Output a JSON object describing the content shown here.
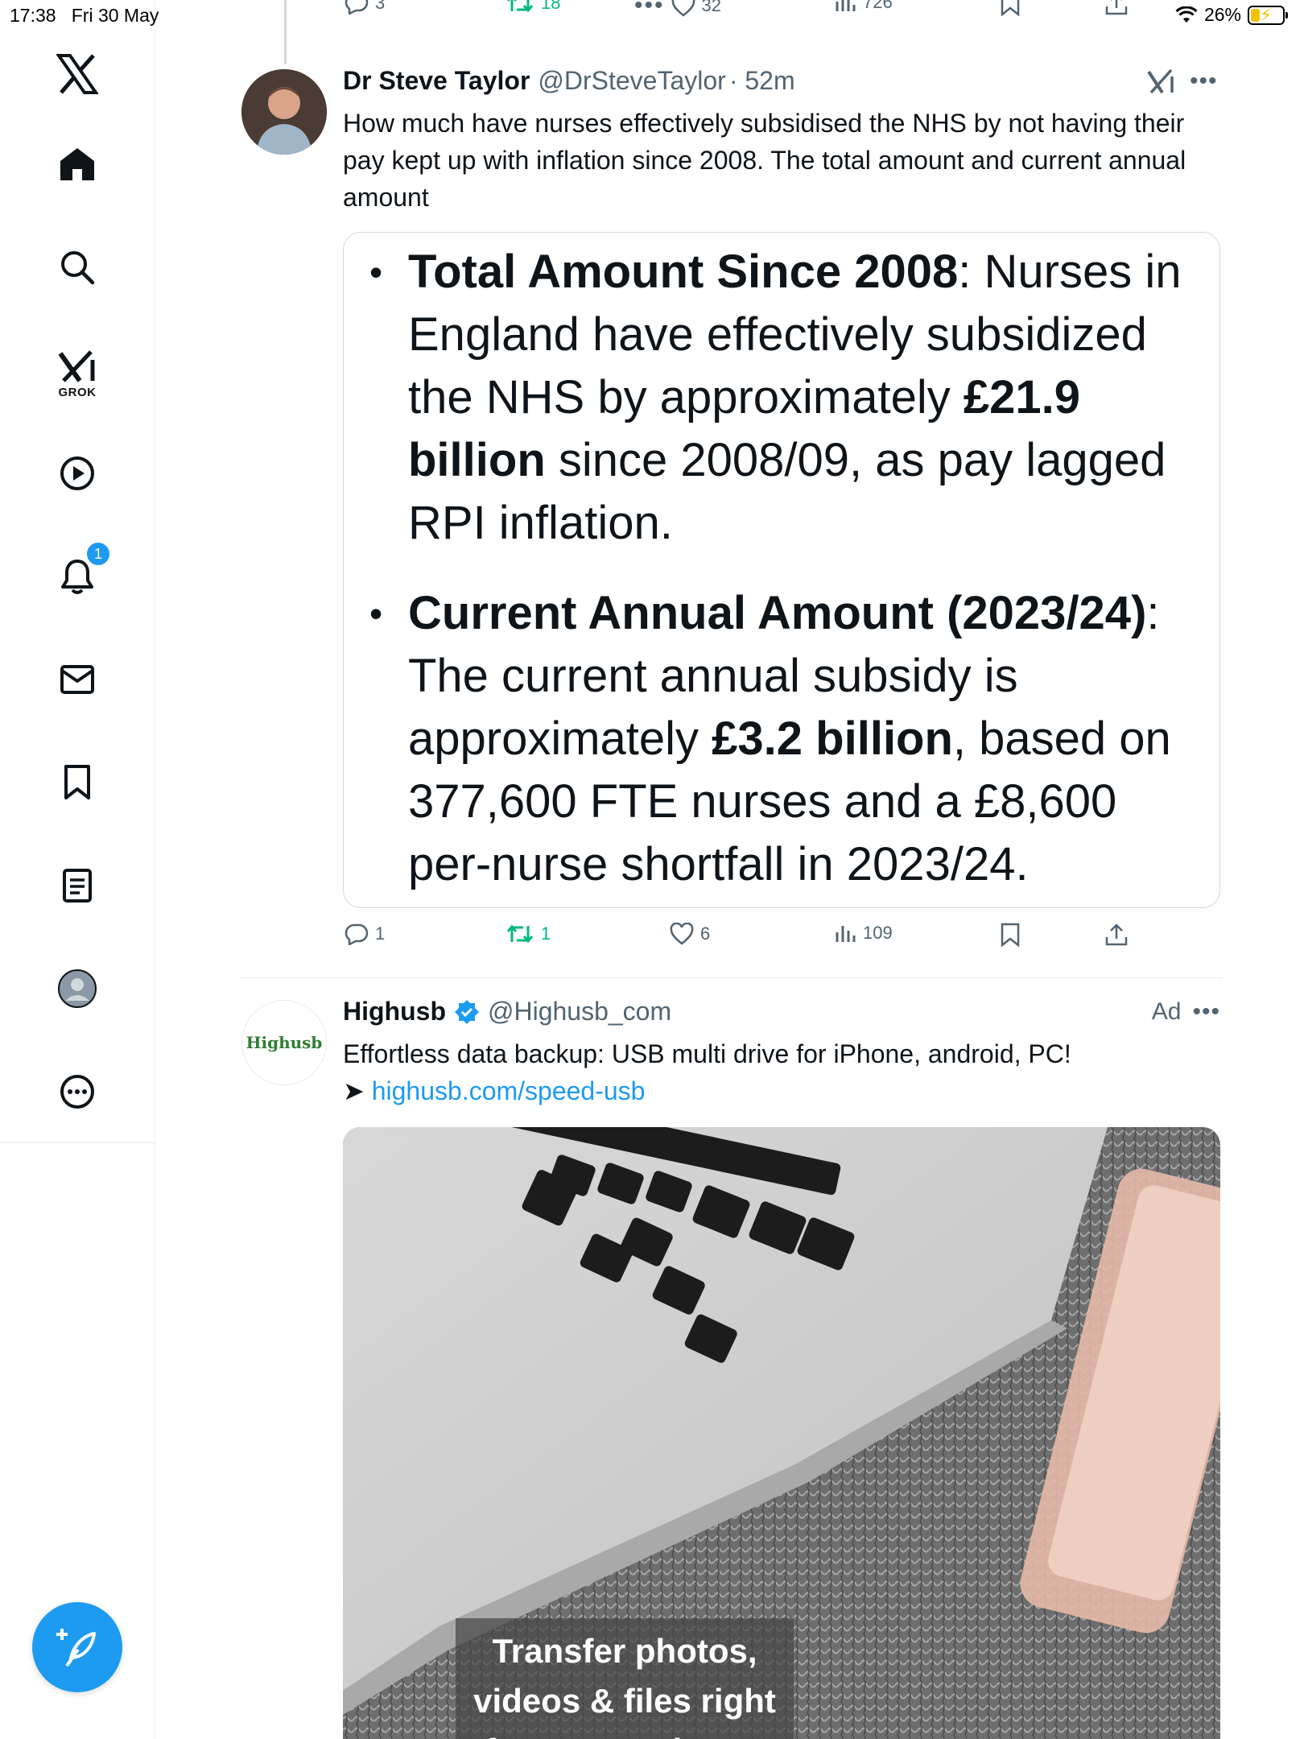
{
  "status_bar": {
    "time": "17:38",
    "date": "Fri 30 May",
    "battery": "26%",
    "battery_level": 0.26
  },
  "sidebar": {
    "items": [
      {
        "name": "x-logo-icon"
      },
      {
        "name": "home-icon"
      },
      {
        "name": "search-icon"
      },
      {
        "name": "grok-icon",
        "label": "GROK"
      },
      {
        "name": "video-icon"
      },
      {
        "name": "notifications-icon",
        "badge": "1"
      },
      {
        "name": "messages-icon"
      },
      {
        "name": "bookmarks-icon"
      },
      {
        "name": "lists-icon"
      },
      {
        "name": "profile-icon"
      },
      {
        "name": "more-icon"
      }
    ],
    "compose_icon": "compose-feather-icon"
  },
  "prev_tweet_actions": {
    "replies": "3",
    "reposts": "18",
    "likes": "32",
    "views": "726"
  },
  "tweet": {
    "name": "Dr Steve Taylor",
    "handle": "@DrSteveTaylor",
    "time": "· 52m",
    "text": "How much have nurses effectively subsidised the NHS by not having their pay kept up with inflation since 2008. The total amount and current annual amount",
    "card": {
      "bullet1": {
        "bold1": "Total Amount Since 2008",
        "text1": ": Nurses in England have effectively subsidized the NHS by approximately ",
        "bold2": "£21.9 billion",
        "text2": " since 2008/09, as pay lagged RPI inflation."
      },
      "bullet2": {
        "bold1": "Current Annual Amount (2023/24)",
        "text1": ": The current annual subsidy is approximately ",
        "bold2": "£3.2 billion",
        "text2": ", based on 377,600 FTE nurses and a £8,600 per-nurse shortfall in 2023/24."
      }
    },
    "actions": {
      "replies": "1",
      "reposts": "1",
      "likes": "6",
      "views": "109"
    }
  },
  "ad_tweet": {
    "name": "Highusb",
    "handle": "@Highusb_com",
    "ad_label": "Ad",
    "avatar_text": "Highusb",
    "text": "Effortless data backup: USB multi drive for iPhone, android, PC!",
    "arrow": "➤",
    "link": "highusb.com/speed-usb",
    "media_caption": "Transfer photos, videos & files right from your phone!"
  },
  "colors": {
    "accent": "#1d9bf0",
    "repost": "#00ba7c",
    "muted": "#536471"
  }
}
